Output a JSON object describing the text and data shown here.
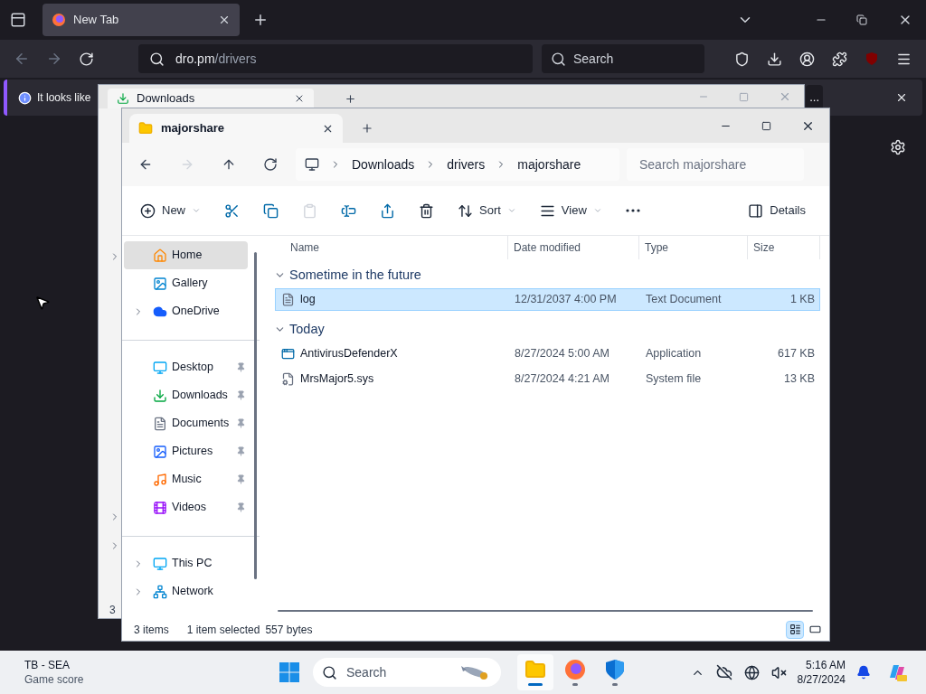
{
  "browser": {
    "tabs": [
      {
        "title": "New Tab",
        "selected": true
      }
    ],
    "address": {
      "host": "dro.pm",
      "path": "/drivers"
    },
    "search": {
      "placeholder": "Search"
    },
    "notification": {
      "text": "It looks like",
      "more": "..."
    }
  },
  "back_window": {
    "tab_title": "Downloads",
    "status_text": "3"
  },
  "explorer": {
    "tab_title": "majorshare",
    "nav_buttons": [
      {
        "kind": "back",
        "disabled": false
      },
      {
        "kind": "forward",
        "disabled": true
      },
      {
        "kind": "up",
        "disabled": false
      },
      {
        "kind": "refresh",
        "disabled": false
      }
    ],
    "breadcrumbs": [
      "Downloads",
      "drivers",
      "majorshare"
    ],
    "search": {
      "placeholder": "Search majorshare"
    },
    "toolbar": [
      {
        "kind": "new",
        "label": "New",
        "menu": true,
        "disabled": false
      },
      {
        "kind": "cut",
        "disabled": false
      },
      {
        "kind": "copy",
        "disabled": false
      },
      {
        "kind": "paste",
        "disabled": true
      },
      {
        "kind": "rename",
        "disabled": false
      },
      {
        "kind": "share",
        "disabled": false
      },
      {
        "kind": "delete",
        "disabled": false
      },
      {
        "kind": "sort",
        "label": "Sort",
        "menu": true,
        "disabled": false
      },
      {
        "kind": "view",
        "label": "View",
        "menu": true,
        "disabled": false
      },
      {
        "kind": "more",
        "disabled": false
      },
      {
        "kind": "details",
        "label": "Details",
        "disabled": false
      }
    ],
    "nav_groups": [
      [
        {
          "kind": "home",
          "label": "Home",
          "expandable": false,
          "pinned": false,
          "selected": true
        },
        {
          "kind": "gallery",
          "label": "Gallery",
          "expandable": false,
          "pinned": false,
          "selected": false
        },
        {
          "kind": "cloud",
          "label": "OneDrive",
          "expandable": true,
          "pinned": false,
          "selected": false
        }
      ],
      [
        {
          "kind": "desktop",
          "label": "Desktop",
          "expandable": false,
          "pinned": true,
          "selected": false
        },
        {
          "kind": "download",
          "label": "Downloads",
          "expandable": false,
          "pinned": true,
          "selected": false
        },
        {
          "kind": "documents",
          "label": "Documents",
          "expandable": false,
          "pinned": true,
          "selected": false
        },
        {
          "kind": "pictures",
          "label": "Pictures",
          "expandable": false,
          "pinned": true,
          "selected": false
        },
        {
          "kind": "music",
          "label": "Music",
          "expandable": false,
          "pinned": true,
          "selected": false
        },
        {
          "kind": "videos",
          "label": "Videos",
          "expandable": false,
          "pinned": true,
          "selected": false
        }
      ],
      [
        {
          "kind": "pc",
          "label": "This PC",
          "expandable": true,
          "pinned": false,
          "selected": false
        },
        {
          "kind": "network",
          "label": "Network",
          "expandable": true,
          "pinned": false,
          "selected": false
        }
      ]
    ],
    "columns": [
      "Name",
      "Date modified",
      "Type",
      "Size"
    ],
    "groups": [
      {
        "label": "Sometime in the future",
        "expanded": true,
        "files": [
          {
            "kind": "text",
            "name": "log",
            "date": "12/31/2037 4:00 PM",
            "type": "Text Document",
            "size": "1 KB",
            "selected": true
          }
        ]
      },
      {
        "label": "Today",
        "expanded": true,
        "files": [
          {
            "kind": "app",
            "name": "AntivirusDefenderX",
            "date": "8/27/2024 5:00 AM",
            "type": "Application",
            "size": "617 KB",
            "selected": false
          },
          {
            "kind": "sys",
            "name": "MrsMajor5.sys",
            "date": "8/27/2024 4:21 AM",
            "type": "System file",
            "size": "13 KB",
            "selected": false
          }
        ]
      }
    ],
    "status": {
      "count": "3 items",
      "selection": "1 item selected",
      "size": "557 bytes"
    },
    "views": [
      {
        "kind": "details",
        "selected": true
      },
      {
        "kind": "tiles",
        "selected": false
      }
    ]
  },
  "taskbar": {
    "widget": {
      "title": "TB - SEA",
      "subtitle": "Game score"
    },
    "search": {
      "placeholder": "Search"
    },
    "apps": [
      {
        "kind": "explorer",
        "active": true
      },
      {
        "kind": "firefox",
        "active": false
      },
      {
        "kind": "defender",
        "active": false
      }
    ],
    "clock": {
      "time": "5:16 AM",
      "date": "8/27/2024"
    }
  }
}
